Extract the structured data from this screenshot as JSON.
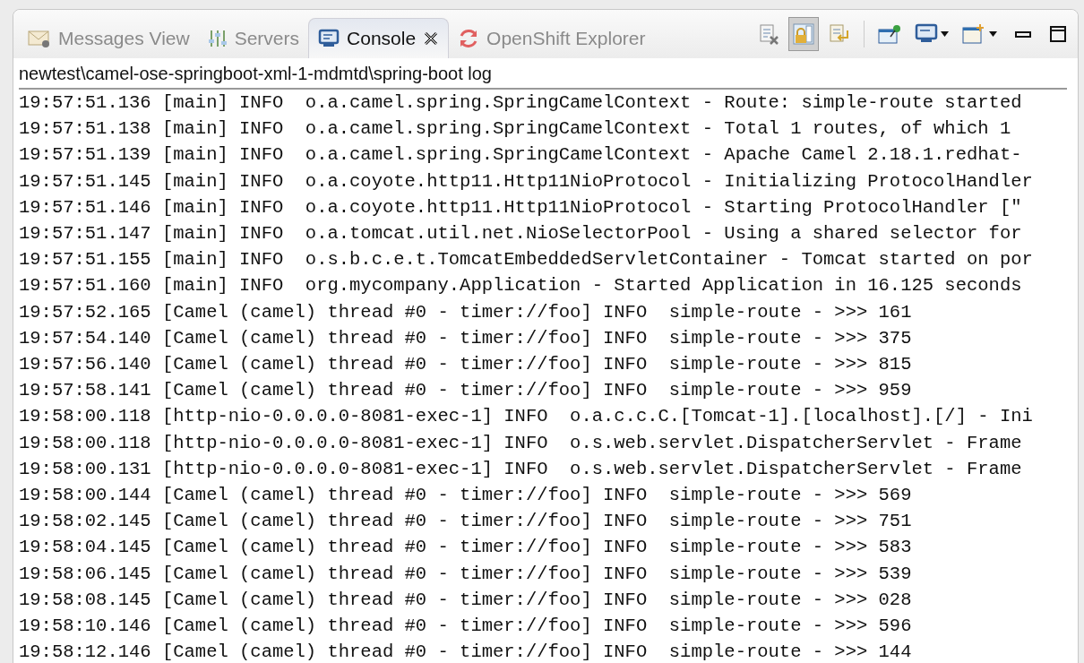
{
  "tabs": [
    {
      "label": "Messages View",
      "kind": "mail",
      "selected": false
    },
    {
      "label": "Servers",
      "kind": "servers",
      "selected": false
    },
    {
      "label": "Console",
      "kind": "console",
      "selected": true
    },
    {
      "label": "OpenShift Explorer",
      "kind": "refresh",
      "selected": false
    }
  ],
  "toolbar_groups": [
    [
      {
        "kind": "clear",
        "pressed": false
      },
      {
        "kind": "scroll-lock",
        "pressed": true
      },
      {
        "kind": "word-wrap",
        "pressed": false
      }
    ],
    [
      {
        "kind": "pin",
        "pressed": false
      },
      {
        "kind": "display",
        "pressed": false
      },
      {
        "kind": "new-console",
        "pressed": false
      }
    ]
  ],
  "window_buttons": [
    {
      "kind": "minimize"
    },
    {
      "kind": "maximize"
    }
  ],
  "console": {
    "title": "newtest\\camel-ose-springboot-xml-1-mdmtd\\spring-boot log",
    "lines": [
      "19:57:51.136 [main] INFO  o.a.camel.spring.SpringCamelContext - Route: simple-route started",
      "19:57:51.138 [main] INFO  o.a.camel.spring.SpringCamelContext - Total 1 routes, of which 1",
      "19:57:51.139 [main] INFO  o.a.camel.spring.SpringCamelContext - Apache Camel 2.18.1.redhat-",
      "19:57:51.145 [main] INFO  o.a.coyote.http11.Http11NioProtocol - Initializing ProtocolHandler",
      "19:57:51.146 [main] INFO  o.a.coyote.http11.Http11NioProtocol - Starting ProtocolHandler [\"",
      "19:57:51.147 [main] INFO  o.a.tomcat.util.net.NioSelectorPool - Using a shared selector for",
      "19:57:51.155 [main] INFO  o.s.b.c.e.t.TomcatEmbeddedServletContainer - Tomcat started on por",
      "19:57:51.160 [main] INFO  org.mycompany.Application - Started Application in 16.125 seconds",
      "19:57:52.165 [Camel (camel) thread #0 - timer://foo] INFO  simple-route - >>> 161",
      "19:57:54.140 [Camel (camel) thread #0 - timer://foo] INFO  simple-route - >>> 375",
      "19:57:56.140 [Camel (camel) thread #0 - timer://foo] INFO  simple-route - >>> 815",
      "19:57:58.141 [Camel (camel) thread #0 - timer://foo] INFO  simple-route - >>> 959",
      "19:58:00.118 [http-nio-0.0.0.0-8081-exec-1] INFO  o.a.c.c.C.[Tomcat-1].[localhost].[/] - Ini",
      "19:58:00.118 [http-nio-0.0.0.0-8081-exec-1] INFO  o.s.web.servlet.DispatcherServlet - Frame",
      "19:58:00.131 [http-nio-0.0.0.0-8081-exec-1] INFO  o.s.web.servlet.DispatcherServlet - Frame",
      "19:58:00.144 [Camel (camel) thread #0 - timer://foo] INFO  simple-route - >>> 569",
      "19:58:02.145 [Camel (camel) thread #0 - timer://foo] INFO  simple-route - >>> 751",
      "19:58:04.145 [Camel (camel) thread #0 - timer://foo] INFO  simple-route - >>> 583",
      "19:58:06.145 [Camel (camel) thread #0 - timer://foo] INFO  simple-route - >>> 539",
      "19:58:08.145 [Camel (camel) thread #0 - timer://foo] INFO  simple-route - >>> 028",
      "19:58:10.146 [Camel (camel) thread #0 - timer://foo] INFO  simple-route - >>> 596",
      "19:58:12.146 [Camel (camel) thread #0 - timer://foo] INFO  simple-route - >>> 144"
    ]
  }
}
